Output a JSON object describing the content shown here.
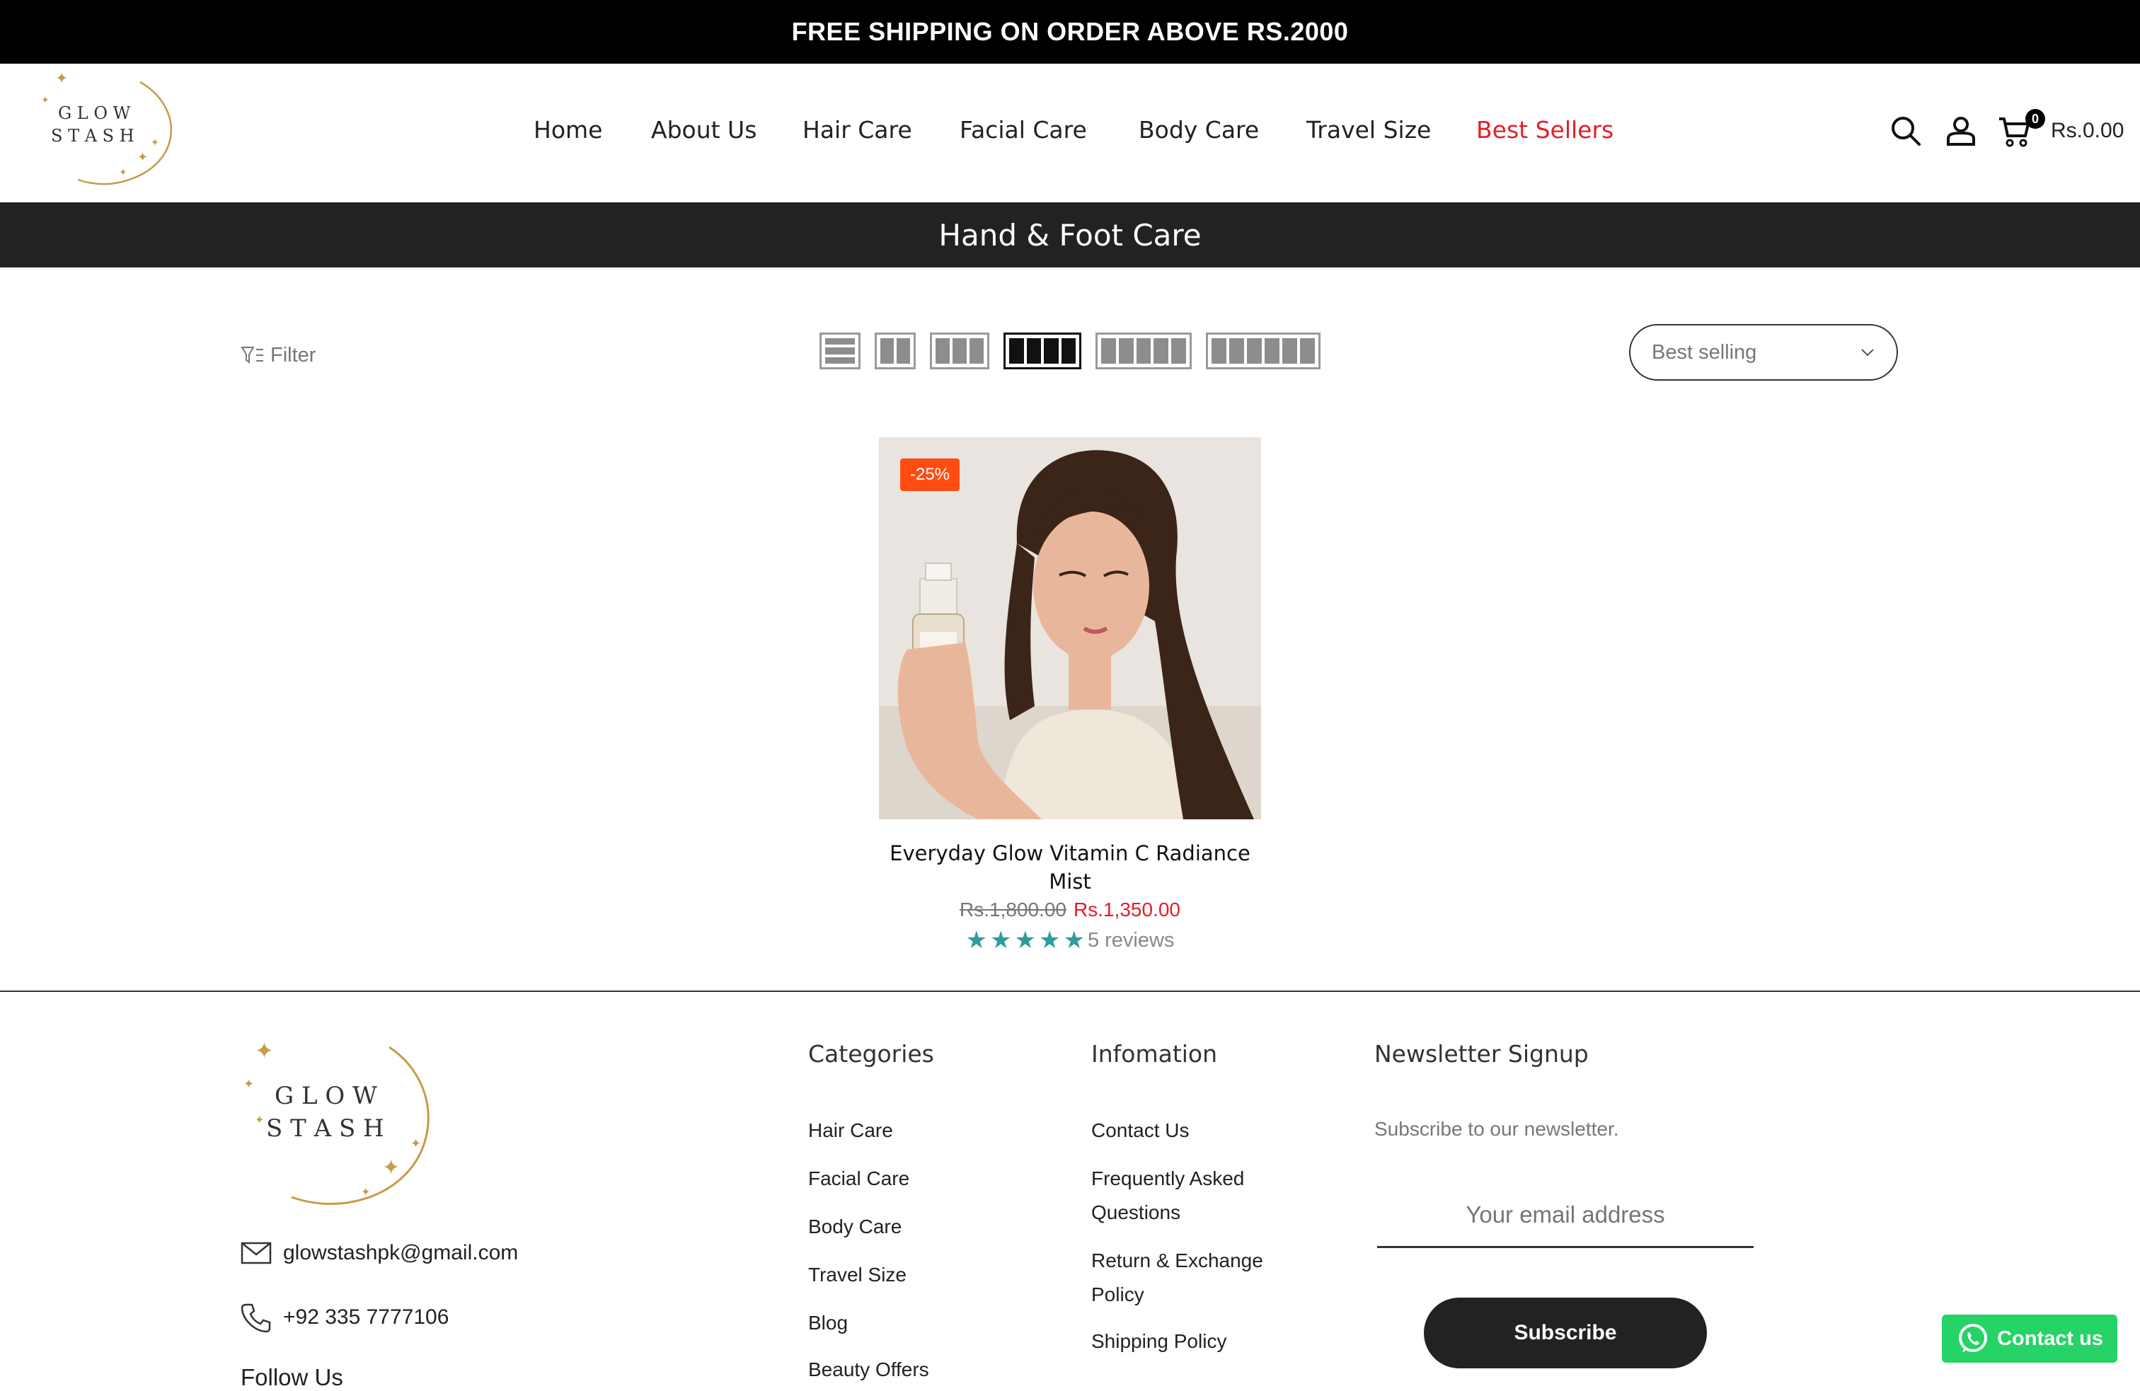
{
  "announcement": "FREE SHIPPING ON ORDER ABOVE RS.2000",
  "logo": {
    "line1": "G L O W",
    "line2": "S T A S H"
  },
  "nav": {
    "items": [
      "Home",
      "About Us",
      "Hair Care",
      "Facial Care",
      "Body Care",
      "Travel Size"
    ],
    "highlight": "Best Sellers"
  },
  "header_icons": [
    "search-icon",
    "account-icon",
    "cart-icon"
  ],
  "cart": {
    "count": "0",
    "total": "Rs.0.00"
  },
  "page_title": "Hand & Foot Care",
  "toolbar": {
    "filter_label": "Filter",
    "layout_options": [
      "list",
      "2-col",
      "3-col",
      "4-col",
      "5-col",
      "6-col"
    ],
    "active_layout": "4-col",
    "sort_value": "Best selling"
  },
  "product": {
    "badge": "-25%",
    "title": "Everyday Glow Vitamin C Radiance Mist",
    "old_price": "Rs.1,800.00",
    "new_price": "Rs.1,350.00",
    "rating": 5,
    "reviews": "5 reviews"
  },
  "footer": {
    "email": "glowstashpk@gmail.com",
    "phone": "+92 335 7777106",
    "follow": "Follow Us",
    "categories": {
      "title": "Categories",
      "links": [
        "Hair Care",
        "Facial Care",
        "Body Care",
        "Travel Size",
        "Blog",
        "Beauty Offers"
      ]
    },
    "information": {
      "title": "Infomation",
      "links": [
        "Contact Us",
        "Frequently Asked Questions",
        "Return & Exchange Policy",
        "Shipping Policy"
      ]
    },
    "newsletter": {
      "title": "Newsletter Signup",
      "subtitle": "Subscribe to our newsletter.",
      "placeholder": "Your email address",
      "button": "Subscribe"
    }
  },
  "whatsapp": {
    "label": "Contact us"
  },
  "colors": {
    "accent": "#e21f26",
    "badge": "#ff4d12",
    "star": "#2f9c9c",
    "whatsapp": "#25d366"
  }
}
